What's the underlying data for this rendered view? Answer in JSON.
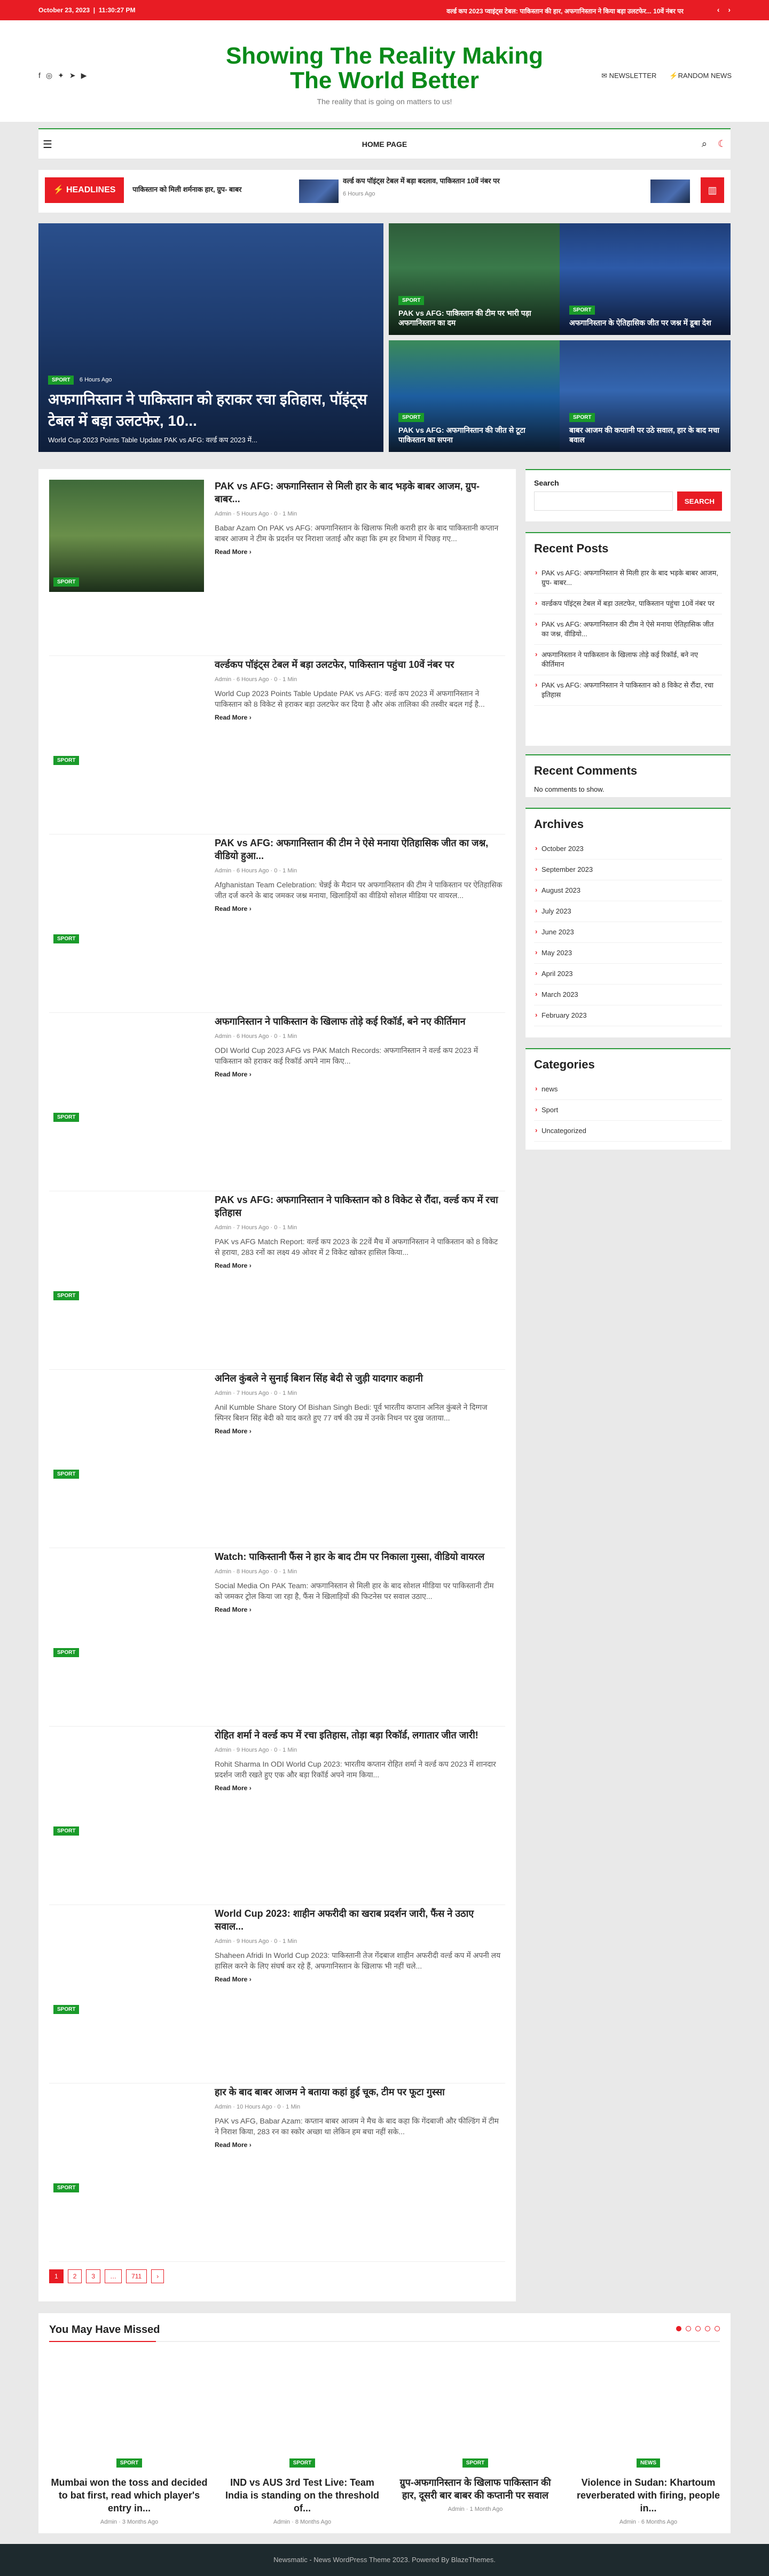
{
  "topbar": {
    "date": "October 23, 2023",
    "time": "11:30:27 PM",
    "ticker": "वर्ल्ड कप 2023 प्वाइंट्स टेबल: पाकिस्तान की हार, अफगानिस्तान ने किया बड़ा उलटफेर... 10वें नंबर पर"
  },
  "site": {
    "title": "Showing The Reality Making The World Better",
    "tagline": "The reality that is going on matters to us!",
    "newsletter": "NEWSLETTER",
    "random": "RANDOM NEWS"
  },
  "nav": {
    "home": "HOME PAGE"
  },
  "headlines": {
    "label": "HEADLINES",
    "items": [
      {
        "title": "पाकिस्तान को मिली शर्मनाक हार, ग्रुप- बाबर",
        "meta": ""
      },
      {
        "title": "वर्ल्ड कप पॉइंट्स टेबल में बड़ा बदलाव, पाकिस्तान 10वें नंबर पर",
        "meta": "6 Hours Ago"
      }
    ]
  },
  "hero": [
    {
      "tag": "SPORT",
      "meta": "6 Hours Ago",
      "title": "अफगानिस्तान ने पाकिस्तान को हराकर रचा इतिहास, पॉइंट्स टेबल में बड़ा उलटफेर, 10...",
      "excerpt": "World Cup 2023 Points Table Update PAK vs AFG: वर्ल्ड कप 2023 में..."
    },
    {
      "tag": "SPORT",
      "title": "PAK vs AFG: पाकिस्तान की टीम पर भारी पड़ा अफगानिस्तान का दम"
    },
    {
      "tag": "SPORT",
      "title": "अफगानिस्तान के ऐतिहासिक जीत पर जश्न में डूबा देश"
    },
    {
      "tag": "SPORT",
      "title": "PAK vs AFG: अफगानिस्तान की जीत से टूटा पाकिस्तान का सपना"
    },
    {
      "tag": "SPORT",
      "title": "बाबर आजम की कप्तानी पर उठे सवाल, हार के बाद मचा बवाल"
    }
  ],
  "posts": [
    {
      "tag": "SPORT",
      "title": "PAK vs AFG: अफगानिस्तान से मिली हार के बाद भड़के बाबर आजम, ग्रुप- बाबर...",
      "meta": "Admin · 5 Hours Ago · 0 · 1 Min",
      "excerpt": "Babar Azam On PAK vs AFG: अफगानिस्तान के खिलाफ मिली करारी हार के बाद पाकिस्तानी कप्तान बाबर आजम ने टीम के प्रदर्शन पर निराशा जताई और कहा कि हम हर विभाग में पिछड़ गए...",
      "read": "Read More"
    },
    {
      "tag": "SPORT",
      "title": "वर्ल्डकप पॉइंट्स टेबल में बड़ा उलटफेर, पाकिस्तान पहुंचा 10वें नंबर पर",
      "meta": "Admin · 6 Hours Ago · 0 · 1 Min",
      "excerpt": "World Cup 2023 Points Table Update PAK vs AFG: वर्ल्ड कप 2023 में अफगानिस्तान ने पाकिस्तान को 8 विकेट से हराकर बड़ा उलटफेर कर दिया है और अंक तालिका की तस्वीर बदल गई है...",
      "read": "Read More"
    },
    {
      "tag": "SPORT",
      "title": "PAK vs AFG: अफगानिस्तान की टीम ने ऐसे मनाया ऐतिहासिक जीत का जश्न, वीडियो हुआ...",
      "meta": "Admin · 6 Hours Ago · 0 · 1 Min",
      "excerpt": "Afghanistan Team Celebration: चेन्नई के मैदान पर अफगानिस्तान की टीम ने पाकिस्तान पर ऐतिहासिक जीत दर्ज करने के बाद जमकर जश्न मनाया, खिलाड़ियों का वीडियो सोशल मीडिया पर वायरल...",
      "read": "Read More"
    },
    {
      "tag": "SPORT",
      "title": "अफगानिस्तान ने पाकिस्तान के खिलाफ तोड़े कई रिकॉर्ड, बने नए कीर्तिमान",
      "meta": "Admin · 6 Hours Ago · 0 · 1 Min",
      "excerpt": "ODI World Cup 2023 AFG vs PAK Match Records: अफगानिस्तान ने वर्ल्ड कप 2023 में पाकिस्तान को हराकर कई रिकॉर्ड अपने नाम किए...",
      "read": "Read More"
    },
    {
      "tag": "SPORT",
      "title": "PAK vs AFG: अफगानिस्तान ने पाकिस्तान को 8 विकेट से रौंदा, वर्ल्ड कप में रचा इतिहास",
      "meta": "Admin · 7 Hours Ago · 0 · 1 Min",
      "excerpt": "PAK vs AFG Match Report: वर्ल्ड कप 2023 के 22वें मैच में अफगानिस्तान ने पाकिस्तान को 8 विकेट से हराया, 283 रनों का लक्ष्य 49 ओवर में 2 विकेट खोकर हासिल किया...",
      "read": "Read More"
    },
    {
      "tag": "SPORT",
      "title": "अनिल कुंबले ने सुनाई बिशन सिंह बेदी से जुड़ी यादगार कहानी",
      "meta": "Admin · 7 Hours Ago · 0 · 1 Min",
      "excerpt": "Anil Kumble Share Story Of Bishan Singh Bedi: पूर्व भारतीय कप्तान अनिल कुंबले ने दिग्गज स्पिनर बिशन सिंह बेदी को याद करते हुए 77 वर्ष की उम्र में उनके निधन पर दुख जताया...",
      "read": "Read More"
    },
    {
      "tag": "SPORT",
      "title": "Watch: पाकिस्तानी फैंस ने हार के बाद टीम पर निकाला गुस्सा, वीडियो वायरल",
      "meta": "Admin · 8 Hours Ago · 0 · 1 Min",
      "excerpt": "Social Media On PAK Team: अफगानिस्तान से मिली हार के बाद सोशल मीडिया पर पाकिस्तानी टीम को जमकर ट्रोल किया जा रहा है, फैंस ने खिलाड़ियों की फिटनेस पर सवाल उठाए...",
      "read": "Read More"
    },
    {
      "tag": "SPORT",
      "title": "रोहित शर्मा ने वर्ल्ड कप में रचा इतिहास, तोड़ा बड़ा रिकॉर्ड, लगातार जीत जारी!",
      "meta": "Admin · 9 Hours Ago · 0 · 1 Min",
      "excerpt": "Rohit Sharma In ODI World Cup 2023: भारतीय कप्तान रोहित शर्मा ने वर्ल्ड कप 2023 में शानदार प्रदर्शन जारी रखते हुए एक और बड़ा रिकॉर्ड अपने नाम किया...",
      "read": "Read More"
    },
    {
      "tag": "SPORT",
      "title": "World Cup 2023: शाहीन अफरीदी का खराब प्रदर्शन जारी, फैंस ने उठाए सवाल...",
      "meta": "Admin · 9 Hours Ago · 0 · 1 Min",
      "excerpt": "Shaheen Afridi In World Cup 2023: पाकिस्तानी तेज गेंदबाज शाहीन अफरीदी वर्ल्ड कप में अपनी लय हासिल करने के लिए संघर्ष कर रहे हैं, अफगानिस्तान के खिलाफ भी नहीं चले...",
      "read": "Read More"
    },
    {
      "tag": "SPORT",
      "title": "हार के बाद बाबर आजम ने बताया कहां हुई चूक, टीम पर फूटा गुस्सा",
      "meta": "Admin · 10 Hours Ago · 0 · 1 Min",
      "excerpt": "PAK vs AFG, Babar Azam: कप्तान बाबर आजम ने मैच के बाद कहा कि गेंदबाजी और फील्डिंग में टीम ने निराश किया, 283 रन का स्कोर अच्छा था लेकिन हम बचा नहीं सके...",
      "read": "Read More"
    }
  ],
  "pager": [
    "1",
    "2",
    "3",
    "…",
    "711",
    "›"
  ],
  "sidebar": {
    "search_label": "Search",
    "search_button": "SEARCH",
    "recent_title": "Recent Posts",
    "recent": [
      "PAK vs AFG: अफगानिस्तान से मिली हार के बाद भड़के बाबर आजम, ग्रुप- बाबर...",
      "वर्ल्डकप पॉइंट्स टेबल में बड़ा उलटफेर, पाकिस्तान पहुंचा 10वें नंबर पर",
      "PAK vs AFG: अफगानिस्तान की टीम ने ऐसे मनाया ऐतिहासिक जीत का जश्न, वीडियो...",
      "अफगानिस्तान ने पाकिस्तान के खिलाफ तोड़े कई रिकॉर्ड, बने नए कीर्तिमान",
      "PAK vs AFG: अफगानिस्तान ने पाकिस्तान को 8 विकेट से रौंदा, रचा इतिहास"
    ],
    "comments_title": "Recent Comments",
    "comments_empty": "No comments to show.",
    "archives_title": "Archives",
    "archives": [
      "October 2023",
      "September 2023",
      "August 2023",
      "July 2023",
      "June 2023",
      "May 2023",
      "April 2023",
      "March 2023",
      "February 2023"
    ],
    "categories_title": "Categories",
    "categories": [
      "news",
      "Sport",
      "Uncategorized"
    ]
  },
  "missed": {
    "title": "You May Have Missed",
    "items": [
      {
        "tag": "SPORT",
        "title": "Mumbai won the toss and decided to bat first, read which player's entry in...",
        "meta": "Admin · 3 Months Ago"
      },
      {
        "tag": "SPORT",
        "title": "IND vs AUS 3rd Test Live: Team India is standing on the threshold of...",
        "meta": "Admin · 8 Months Ago"
      },
      {
        "tag": "SPORT",
        "title": "ग्रुप-अफगानिस्तान के खिलाफ पाकिस्तान की हार, दूसरी बार बाबर की कप्तानी पर सवाल",
        "meta": "Admin · 1 Month Ago"
      },
      {
        "tag": "NEWS",
        "title": "Violence in Sudan: Khartoum reverberated with firing, people in...",
        "meta": "Admin · 6 Months Ago"
      }
    ]
  },
  "footer": "Newsmatic - News WordPress Theme 2023. Powered By BlazeThemes."
}
